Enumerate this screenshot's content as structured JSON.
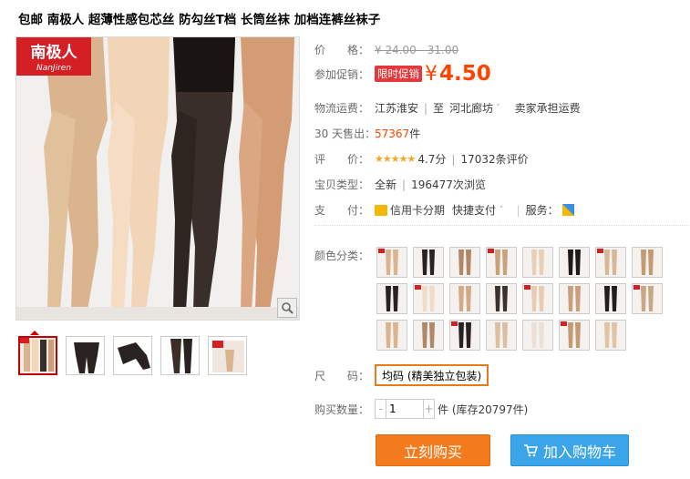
{
  "product": {
    "title": "包邮 南极人 超薄性感包芯丝 防勾丝T档 长筒丝袜 加档连裤丝袜子",
    "brand_logo_main": "南极人",
    "brand_logo_sub": "NanJiren"
  },
  "price": {
    "label": "价　　格：",
    "original": "¥ 24.00 - 31.00"
  },
  "promo": {
    "label": "参加促销：",
    "badge": "限时促销",
    "currency": "¥",
    "value": "4.50"
  },
  "shipping": {
    "label": "物流运费：",
    "from": "江苏淮安",
    "to_prefix": "至",
    "to": "河北廊坊",
    "fee": "卖家承担运费"
  },
  "sales": {
    "label": "30 天售出：",
    "count": "57367",
    "unit": "件"
  },
  "rating": {
    "label": "评　　价：",
    "stars": "★★★★★",
    "score": "4.7分",
    "reviews": "17032条评价"
  },
  "type": {
    "label": "宝贝类型：",
    "condition": "全新",
    "views": "196477次浏览"
  },
  "payment": {
    "label": "支　　付：",
    "credit": "信用卡分期",
    "quick": "快捷支付",
    "service_label": "服务："
  },
  "color": {
    "label": "颜色分类：",
    "swatch_count": 23
  },
  "size": {
    "label": "尺　　码：",
    "value": "均码 (精美独立包装)"
  },
  "quantity": {
    "label": "购买数量：",
    "minus": "-",
    "value": "1",
    "plus": "+",
    "stock": "件 (库存20797件)"
  },
  "buttons": {
    "buy": "立刻购买",
    "cart": "加入购物车"
  },
  "colors": {
    "accent_orange": "#ff4400",
    "buy_button": "#f37b1d",
    "cart_button": "#3aa5e8",
    "promo_badge": "#e4393c",
    "logo_red": "#d41f25"
  }
}
